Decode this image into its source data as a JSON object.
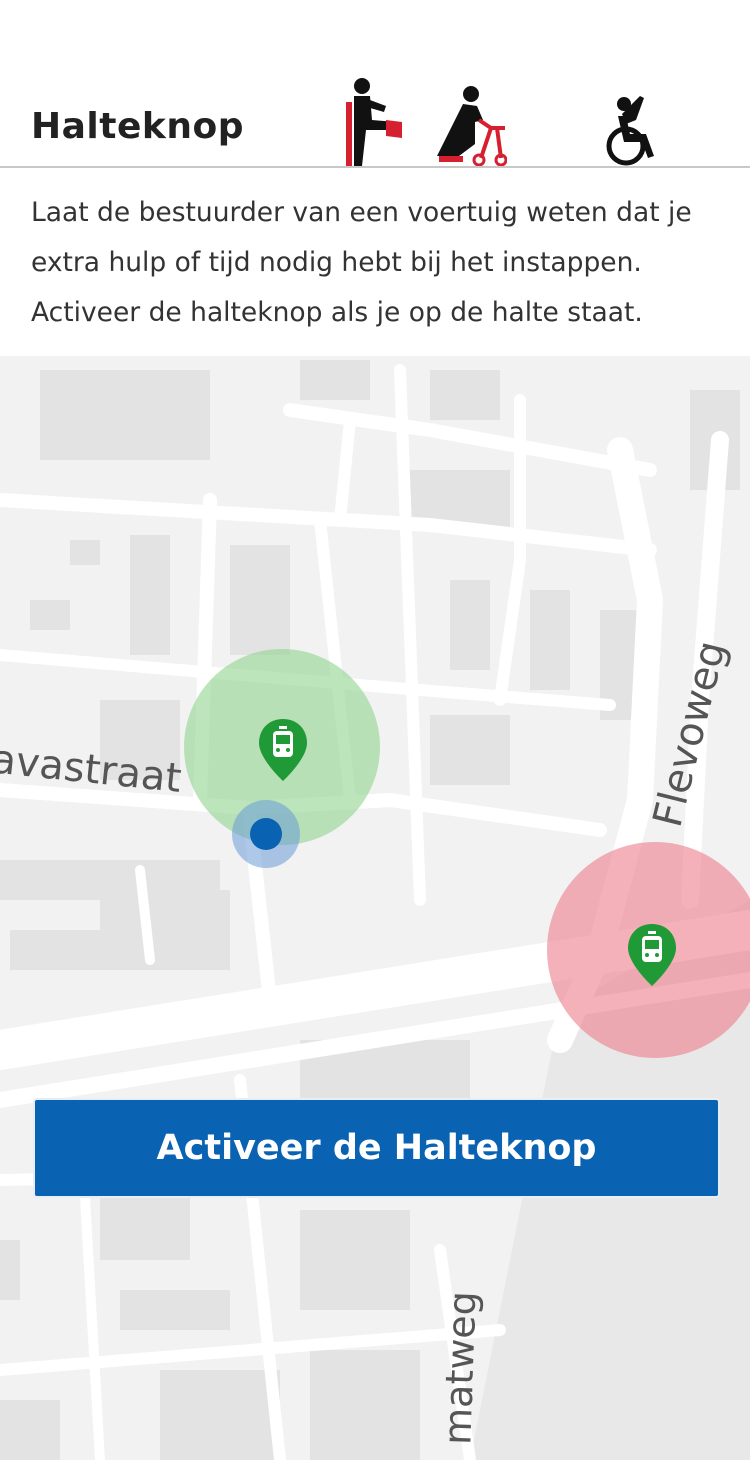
{
  "header": {
    "title": "Halteknop",
    "pictograms": [
      "person-with-leg-cast-icon",
      "elderly-with-walker-icon",
      "wheelchair-user-icon"
    ]
  },
  "description": "Laat de bestuurder van een voertuig weten dat je extra hulp of tijd nodig hebt bij het instappen. Activeer de halteknop als je op de halte staat.",
  "map": {
    "street_labels": {
      "javastraat": "Javastraat",
      "flevoweg": "Flevoweg",
      "bottom": "matweg"
    },
    "stops": [
      {
        "name": "tram-stop-icon",
        "zone_color": "#8fd38f",
        "status": "in-range"
      },
      {
        "name": "tram-stop-icon",
        "zone_color": "#ee7d8a",
        "status": "out-of-range"
      }
    ],
    "user_location_color": "#0a62b3"
  },
  "cta": {
    "label": "Activeer de Halteknop",
    "color": "#0a62b3"
  }
}
